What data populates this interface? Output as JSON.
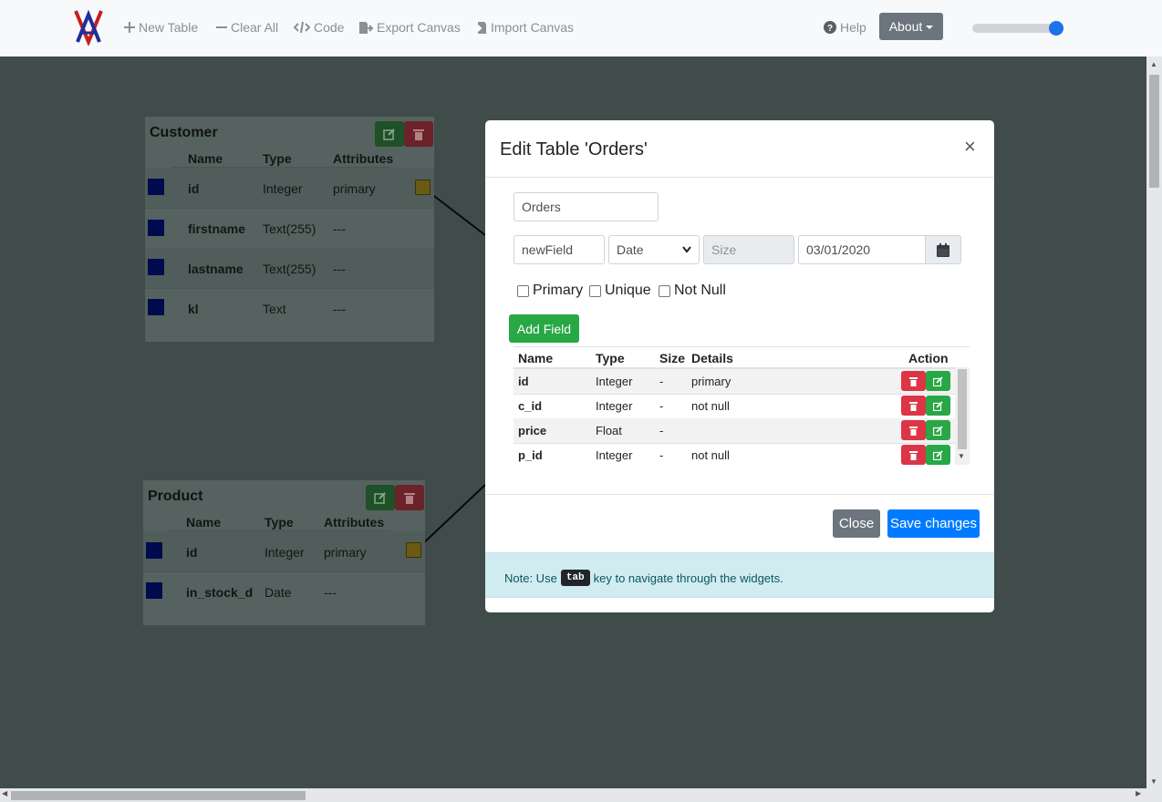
{
  "navbar": {
    "items": [
      {
        "label": "New Table",
        "icon": "plus-icon"
      },
      {
        "label": "Clear All",
        "icon": "minus-icon"
      },
      {
        "label": "Code",
        "icon": "code-icon"
      },
      {
        "label": "Export Canvas",
        "icon": "export-icon"
      },
      {
        "label": "Import Canvas",
        "icon": "import-icon"
      }
    ],
    "help_label": "Help",
    "about_label": "About",
    "zoom_level": 0.92
  },
  "tables": {
    "customer": {
      "title": "Customer",
      "headers": [
        "Name",
        "Type",
        "Attributes"
      ],
      "rows": [
        {
          "name": "id",
          "type": "Integer",
          "attributes": "primary"
        },
        {
          "name": "firstname",
          "type": "Text(255)",
          "attributes": "---"
        },
        {
          "name": "lastname",
          "type": "Text(255)",
          "attributes": "---"
        },
        {
          "name": "kl",
          "type": "Text",
          "attributes": "---"
        }
      ]
    },
    "product": {
      "title": "Product",
      "headers": [
        "Name",
        "Type",
        "Attributes"
      ],
      "rows": [
        {
          "name": "id",
          "type": "Integer",
          "attributes": "primary"
        },
        {
          "name": "in_stock_d",
          "type": "Date",
          "attributes": "---"
        }
      ]
    }
  },
  "modal": {
    "title": "Edit Table 'Orders'",
    "close_symbol": "×",
    "table_name_value": "Orders",
    "field_name_value": "newField",
    "type_value": "Date",
    "size_placeholder": "Size",
    "date_value": "03/01/2020",
    "checkboxes": {
      "primary": "Primary",
      "unique": "Unique",
      "not_null": "Not Null"
    },
    "add_field_label": "Add Field",
    "field_table": {
      "headers": {
        "name": "Name",
        "type": "Type",
        "size": "Size",
        "details": "Details",
        "action": "Action"
      },
      "rows": [
        {
          "name": "id",
          "type": "Integer",
          "size": "-",
          "details": "primary"
        },
        {
          "name": "c_id",
          "type": "Integer",
          "size": "-",
          "details": "not null"
        },
        {
          "name": "price",
          "type": "Float",
          "size": "-",
          "details": ""
        },
        {
          "name": "p_id",
          "type": "Integer",
          "size": "-",
          "details": "not null"
        }
      ]
    },
    "close_label": "Close",
    "save_label": "Save changes",
    "note": {
      "prefix": "Note: Use",
      "key": "tab",
      "suffix": "key to navigate through the widgets."
    }
  },
  "colors": {
    "primary": "#007bff",
    "success": "#28a745",
    "danger": "#dc3545",
    "secondary": "#6c757d",
    "info_bg": "#d1ecf1"
  }
}
